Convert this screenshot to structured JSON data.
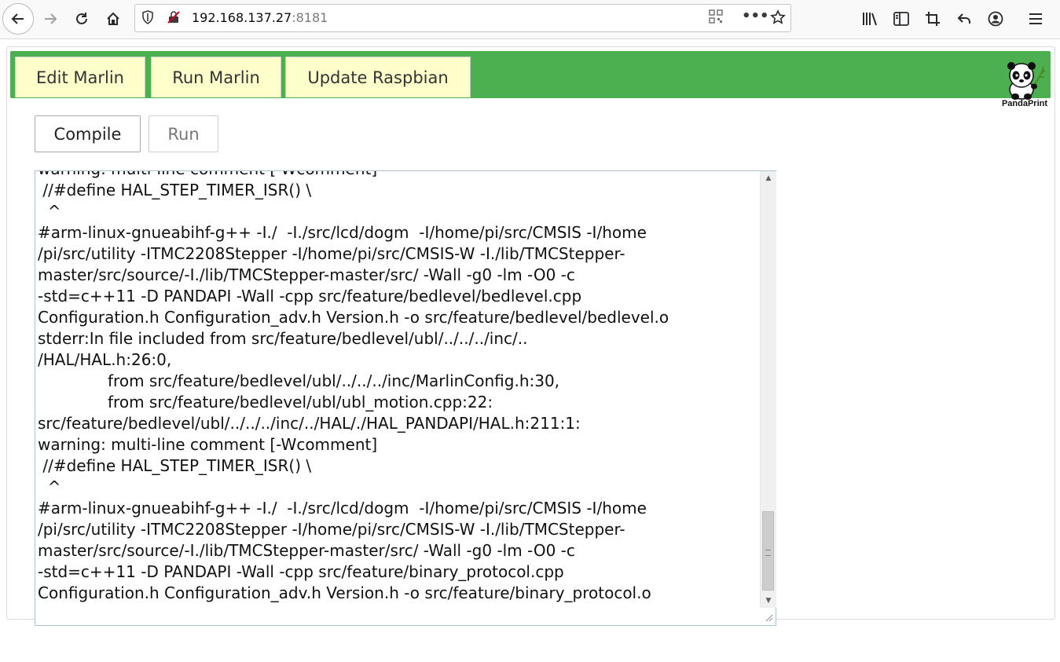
{
  "browser": {
    "url_host": "192.168.137.27",
    "url_port": ":8181"
  },
  "nav": {
    "tabs": [
      "Edit Marlin",
      "Run Marlin",
      "Update Raspbian"
    ],
    "logo_text": "PandaPrint"
  },
  "actions": {
    "compile_label": "Compile",
    "run_label": "Run"
  },
  "console": {
    "lines": [
      "warning: multi-line comment [-Wcomment]",
      " //#define HAL_STEP_TIMER_ISR() \\",
      "  ^",
      "#arm-linux-gnueabihf-g++ -I./  -I./src/lcd/dogm  -I/home/pi/src/CMSIS -I/home",
      "/pi/src/utility -ITMC2208Stepper -I/home/pi/src/CMSIS-W -I./lib/TMCStepper-",
      "master/src/source/-I./lib/TMCStepper-master/src/ -Wall -g0 -lm -O0 -c",
      "-std=c++11 -D PANDAPI -Wall -cpp src/feature/bedlevel/bedlevel.cpp",
      "Configuration.h Configuration_adv.h Version.h -o src/feature/bedlevel/bedlevel.o",
      "stderr:In file included from src/feature/bedlevel/ubl/../../../inc/..",
      "/HAL/HAL.h:26:0,",
      "              from src/feature/bedlevel/ubl/../../../inc/MarlinConfig.h:30,",
      "              from src/feature/bedlevel/ubl/ubl_motion.cpp:22:",
      "src/feature/bedlevel/ubl/../../../inc/../HAL/./HAL_PANDAPI/HAL.h:211:1:",
      "warning: multi-line comment [-Wcomment]",
      " //#define HAL_STEP_TIMER_ISR() \\",
      "  ^",
      "#arm-linux-gnueabihf-g++ -I./  -I./src/lcd/dogm  -I/home/pi/src/CMSIS -I/home",
      "/pi/src/utility -ITMC2208Stepper -I/home/pi/src/CMSIS-W -I./lib/TMCStepper-",
      "master/src/source/-I./lib/TMCStepper-master/src/ -Wall -g0 -lm -O0 -c",
      "-std=c++11 -D PANDAPI -Wall -cpp src/feature/binary_protocol.cpp",
      "Configuration.h Configuration_adv.h Version.h -o src/feature/binary_protocol.o"
    ]
  },
  "colors": {
    "nav_bar": "#4caf50",
    "tab_bg": "#ffffcc"
  },
  "icons": [
    "back-arrow-icon",
    "forward-arrow-icon",
    "reload-icon",
    "home-icon",
    "shield-icon",
    "insecure-lock-icon",
    "qr-code-icon",
    "more-icon",
    "star-icon",
    "library-icon",
    "sidebar-icon",
    "crop-icon",
    "undo-icon",
    "account-icon",
    "menu-icon"
  ]
}
